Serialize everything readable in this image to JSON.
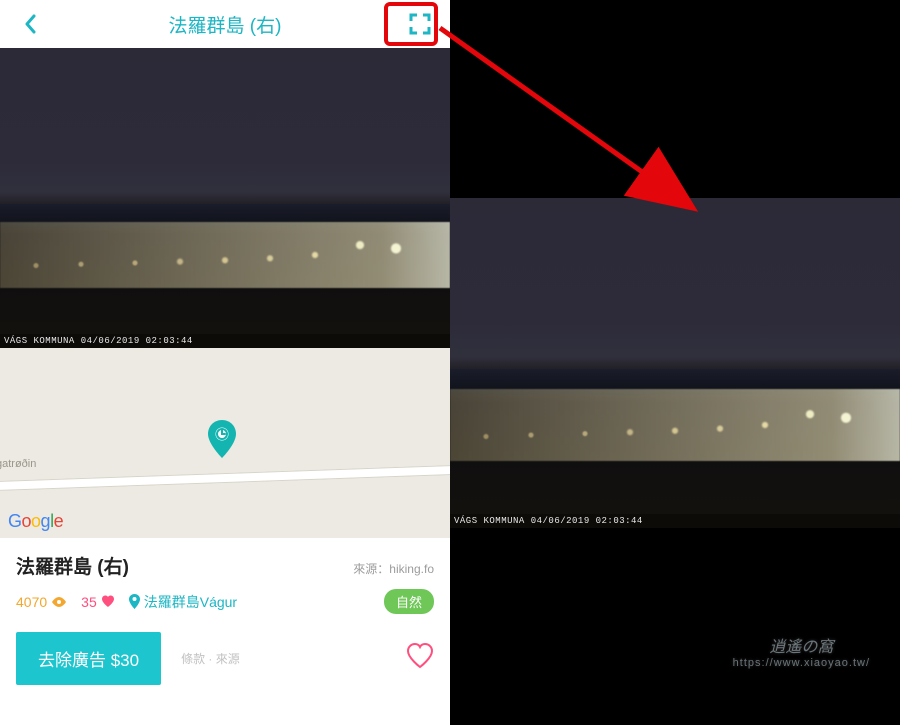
{
  "header": {
    "title": "法羅群島 (右)"
  },
  "webcam": {
    "timestamp": "VÁGS KOMMUNA 04/06/2019 02:03:44"
  },
  "map": {
    "road_label": "gatrøðin",
    "attribution": "Google"
  },
  "info": {
    "title": "法羅群島 (右)",
    "source_prefix": "來源：",
    "source": "hiking.fo",
    "views": "4070",
    "likes": "35",
    "location": "法羅群島Vágur",
    "tag": "自然"
  },
  "bottom": {
    "remove_ads": "去除廣告 $30",
    "links": "條款 · 來源"
  },
  "watermark": {
    "line1": "逍遙の窩",
    "line2": "https://www.xiaoyao.tw/"
  }
}
